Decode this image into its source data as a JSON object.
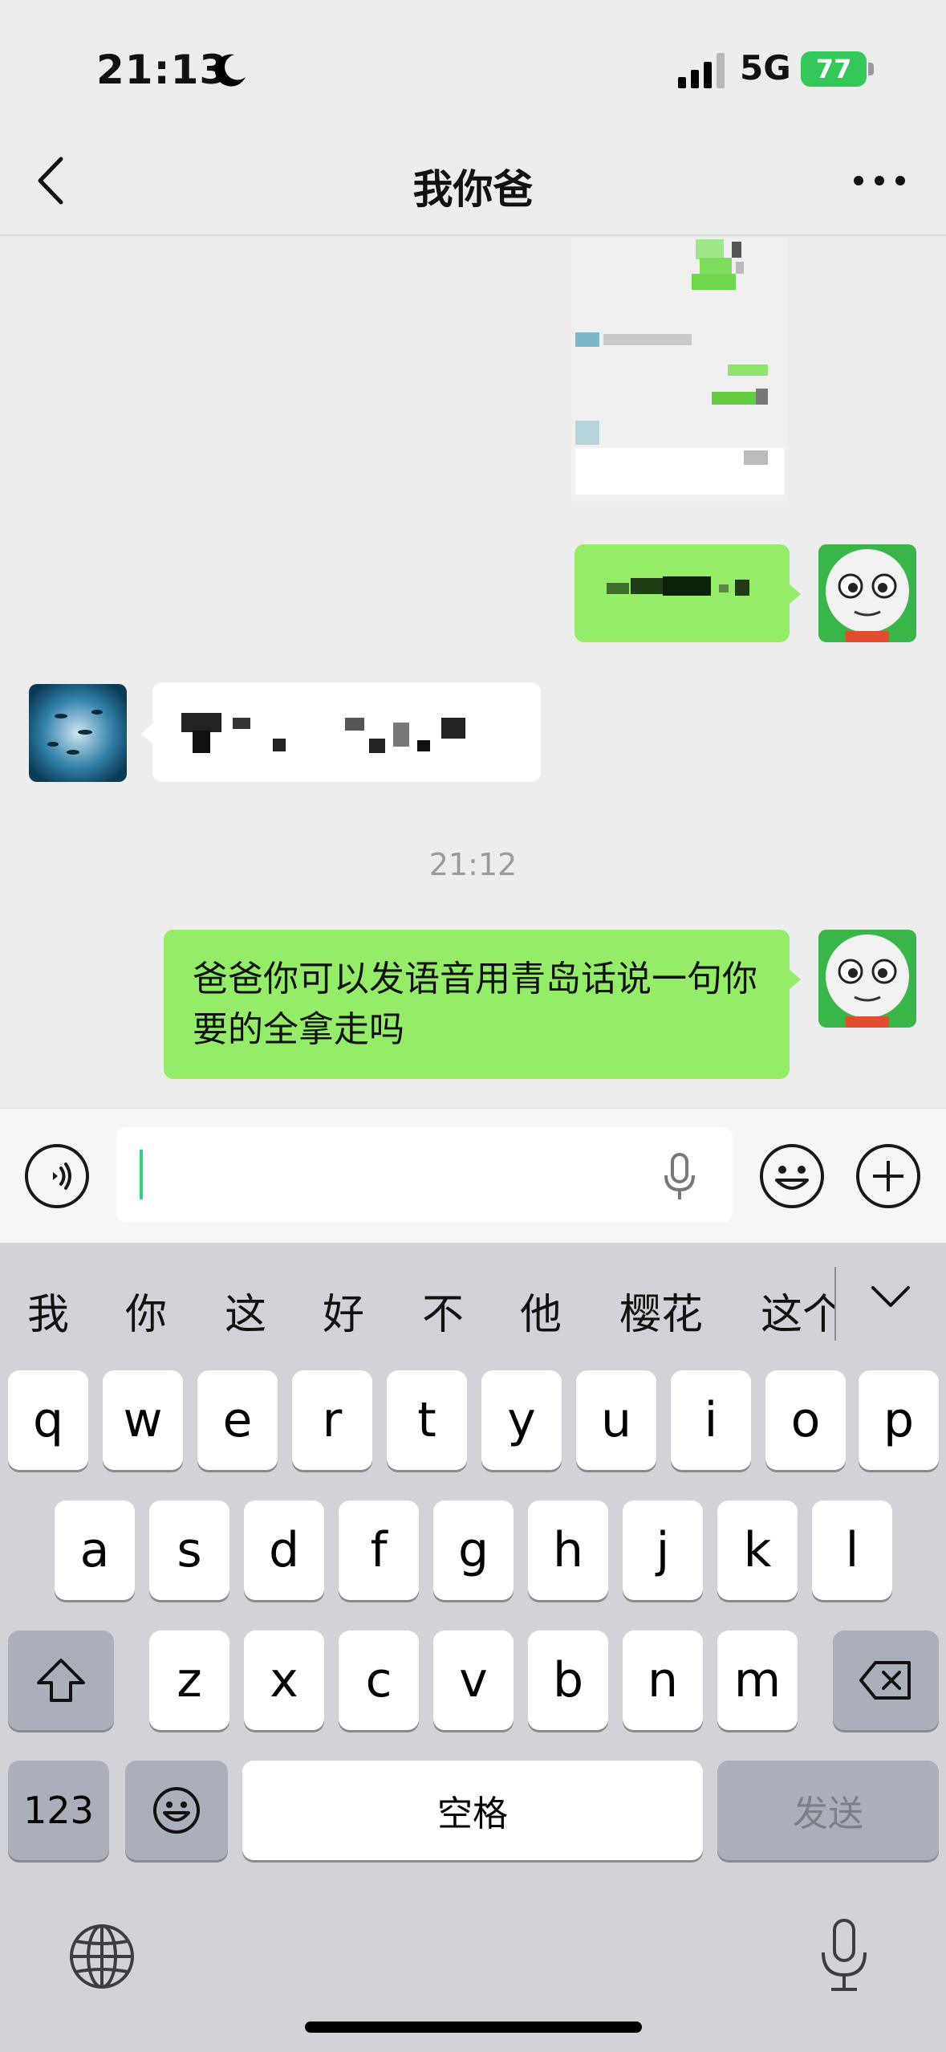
{
  "status_bar": {
    "time": "21:13",
    "network": "5G",
    "battery": "77"
  },
  "nav": {
    "title": "我你爸"
  },
  "messages": {
    "timestamp": "21:12",
    "last_sent": "爸爸你可以发语音用青岛话说一句你要的全拿走吗"
  },
  "input": {
    "value": ""
  },
  "keyboard": {
    "candidates": [
      "我",
      "你",
      "这",
      "好",
      "不",
      "他",
      "樱花",
      "这个"
    ],
    "row1": [
      "q",
      "w",
      "e",
      "r",
      "t",
      "y",
      "u",
      "i",
      "o",
      "p"
    ],
    "row2": [
      "a",
      "s",
      "d",
      "f",
      "g",
      "h",
      "j",
      "k",
      "l"
    ],
    "row3": [
      "z",
      "x",
      "c",
      "v",
      "b",
      "n",
      "m"
    ],
    "numbers_label": "123",
    "space_label": "空格",
    "send_label": "发送"
  },
  "colors": {
    "sent_bubble": "#95ec69",
    "received_bubble": "#ffffff",
    "background": "#ededed",
    "battery": "#34c759"
  }
}
